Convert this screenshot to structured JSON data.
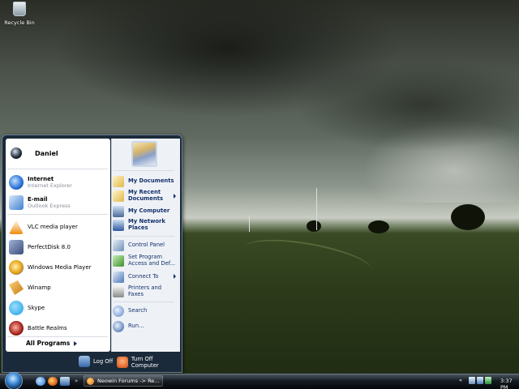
{
  "desktop": {
    "icons": [
      {
        "label": "Recycle Bin",
        "icon": "recycle-bin-icon"
      }
    ]
  },
  "start_menu": {
    "user": {
      "name": "Daniel"
    },
    "pinned": [
      {
        "title": "Internet",
        "subtitle": "Internet Explorer",
        "icon": "internet-explorer-icon",
        "color": "#2a6fd6"
      },
      {
        "title": "E-mail",
        "subtitle": "Outlook Express",
        "icon": "outlook-express-icon",
        "color": "#3b7fd0"
      }
    ],
    "recent": [
      {
        "label": "VLC media player",
        "icon": "vlc-icon",
        "color": "#f08a0c"
      },
      {
        "label": "PerfectDisk 8.0",
        "icon": "perfectdisk-icon",
        "color": "#3a4d7a"
      },
      {
        "label": "Windows Media Player",
        "icon": "windows-media-player-icon",
        "color": "#e8a317"
      },
      {
        "label": "Winamp",
        "icon": "winamp-icon",
        "color": "#c47a12"
      },
      {
        "label": "Skype",
        "icon": "skype-icon",
        "color": "#1aa0e0"
      },
      {
        "label": "Battle Realms",
        "icon": "battle-realms-icon",
        "color": "#a3201a"
      }
    ],
    "all_programs": "All Programs",
    "right": [
      {
        "label": "My Documents",
        "icon": "my-documents-icon",
        "bold": true,
        "arrow": false
      },
      {
        "label": "My Recent Documents",
        "icon": "my-recent-documents-icon",
        "bold": true,
        "arrow": true
      },
      {
        "label": "My Computer",
        "icon": "my-computer-icon",
        "bold": true,
        "arrow": false
      },
      {
        "label": "My Network Places",
        "icon": "my-network-places-icon",
        "bold": true,
        "arrow": false
      },
      {
        "label": "Control Panel",
        "icon": "control-panel-icon",
        "bold": false,
        "arrow": false
      },
      {
        "label": "Set Program Access and Def...",
        "icon": "set-program-access-icon",
        "bold": false,
        "arrow": false
      },
      {
        "label": "Connect To",
        "icon": "connect-to-icon",
        "bold": false,
        "arrow": true
      },
      {
        "label": "Printers and Faxes",
        "icon": "printers-faxes-icon",
        "bold": false,
        "arrow": false
      },
      {
        "label": "Search",
        "icon": "search-icon",
        "bold": false,
        "arrow": false
      },
      {
        "label": "Run...",
        "icon": "run-icon",
        "bold": false,
        "arrow": false
      }
    ],
    "log_off": "Log Off",
    "turn_off": "Turn Off Computer"
  },
  "taskbar": {
    "start_icon": "start-orb-icon",
    "quick_launch": [
      "internet-explorer-icon",
      "firefox-icon",
      "show-desktop-icon"
    ],
    "overflow": "»",
    "tasks": [
      {
        "label": "Neowin Forums -> Re...",
        "icon": "firefox-icon"
      }
    ],
    "tray": {
      "chevron": "«",
      "icons": [
        "network-icon",
        "volume-icon",
        "security-icon"
      ],
      "clock": "3:37 PM"
    }
  }
}
